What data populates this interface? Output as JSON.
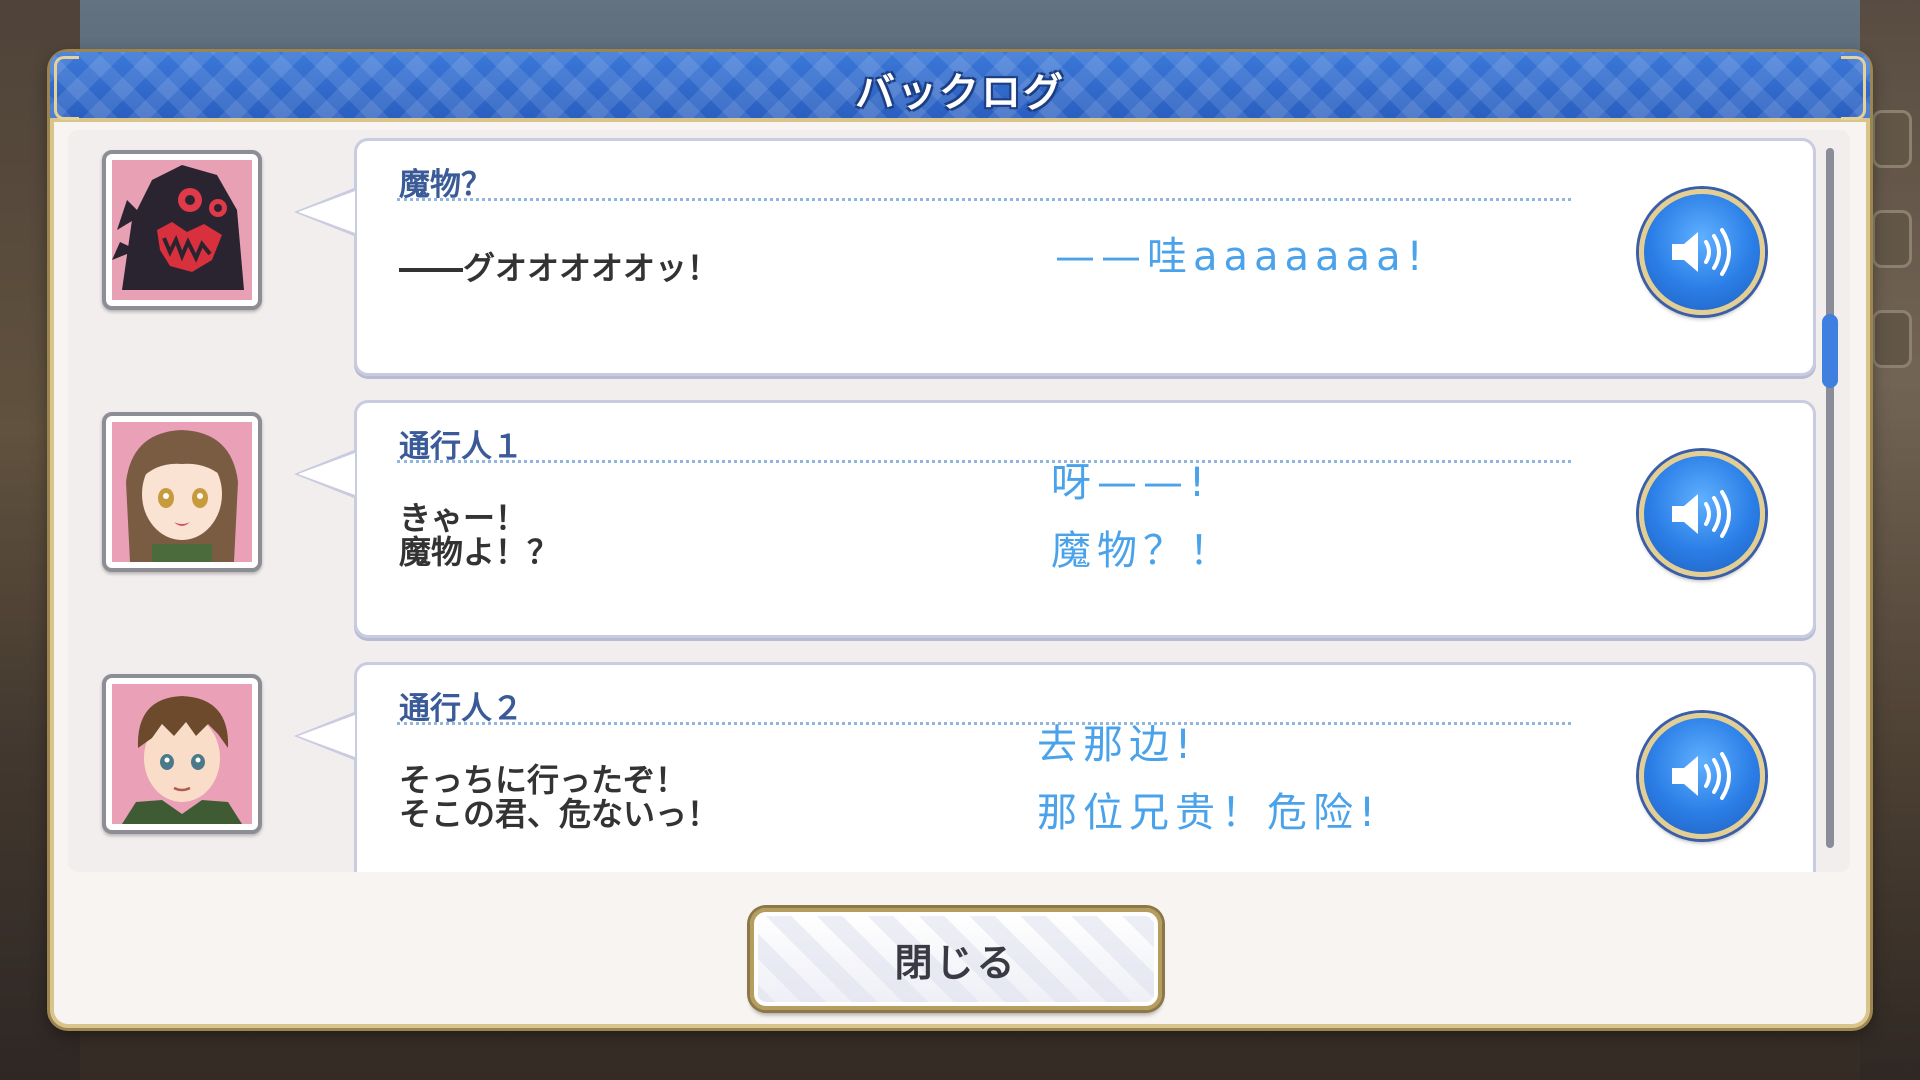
{
  "window": {
    "title": "バックログ"
  },
  "entries": [
    {
      "speaker": "魔物？",
      "text": "――グオオオオオッ！",
      "translation": "——哇aaaaaaa!",
      "portrait": "monster-portrait",
      "voice_icon": "speaker-icon"
    },
    {
      "speaker": "通行人１",
      "text": "きゃー！\n魔物よ！？",
      "translation": "呀——!\n魔物？！",
      "portrait": "girl-portrait",
      "voice_icon": "speaker-icon"
    },
    {
      "speaker": "通行人２",
      "text": "そっちに行ったぞ！\nそこの君、危ないっ！",
      "translation": "去那边!\n那位兄贵！危险!",
      "portrait": "boy-portrait",
      "voice_icon": "speaker-icon"
    }
  ],
  "buttons": {
    "close_label": "閉じる"
  },
  "colors": {
    "header_blue": "#2a5fc0",
    "speaker_text": "#3b5a98",
    "translation_text": "#4aa3ea",
    "gold_border": "#d9c48b",
    "scroll_thumb": "#3f7fe0"
  }
}
